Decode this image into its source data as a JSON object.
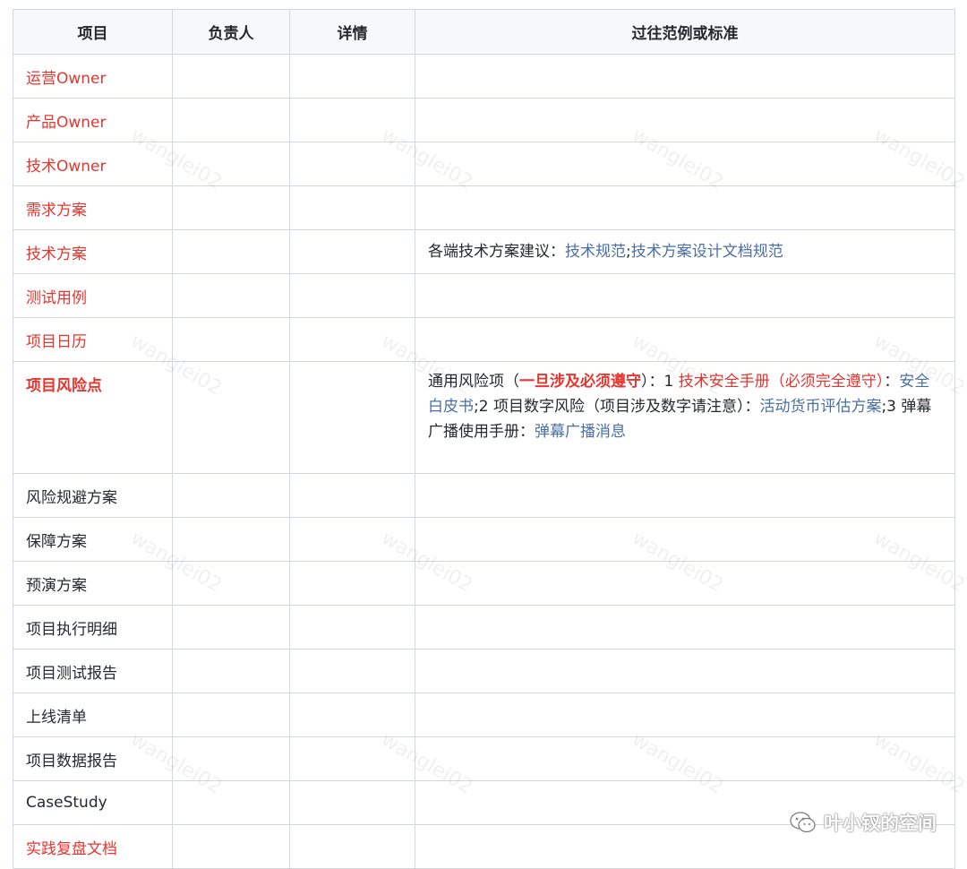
{
  "headers": [
    "项目",
    "负责人",
    "详情",
    "过往范例或标准"
  ],
  "rows": [
    {
      "item": "运营Owner",
      "style": "red"
    },
    {
      "item": "产品Owner",
      "style": "red"
    },
    {
      "item": "技术Owner",
      "style": "red"
    },
    {
      "item": "需求方案",
      "style": "red"
    },
    {
      "item": "技术方案",
      "style": "red"
    },
    {
      "item": "测试用例",
      "style": "red"
    },
    {
      "item": "项目日历",
      "style": "red"
    },
    {
      "item": "项目风险点",
      "style": "red-bold"
    },
    {
      "item": "风险规避方案",
      "style": "normal"
    },
    {
      "item": "保障方案",
      "style": "normal"
    },
    {
      "item": "预演方案",
      "style": "normal"
    },
    {
      "item": "项目执行明细",
      "style": "normal"
    },
    {
      "item": "项目测试报告",
      "style": "normal"
    },
    {
      "item": "上线清单",
      "style": "normal"
    },
    {
      "item": "项目数据报告",
      "style": "normal"
    },
    {
      "item": "CaseStudy",
      "style": "normal"
    },
    {
      "item": "实践复盘文档",
      "style": "red"
    }
  ],
  "tech_standard": {
    "prefix": "各端技术方案建议：",
    "link1": "技术规范",
    "sep": ";",
    "link2": "技术方案设计文档规范"
  },
  "risk_standard": {
    "p1": "通用风险项（",
    "r1": "一旦涉及必须遵守",
    "p2": "）：1 ",
    "r2": "技术安全手册（必须完全遵守）",
    "p3": "：",
    "l1": "安全白皮书",
    "p4": ";2 项目数字风险（项目涉及数字请注意）：",
    "l2": "活动货币评估方案",
    "p5": ";3 弹幕广播使用手册：",
    "l3": "弹幕广播消息"
  },
  "watermark": "wanglei02",
  "brand": "叶小钗的空间",
  "colors": {
    "red": "#e7352f",
    "link": "#4a6fa5",
    "header_bg": "#f6f8fa",
    "border": "#d0d7de"
  }
}
